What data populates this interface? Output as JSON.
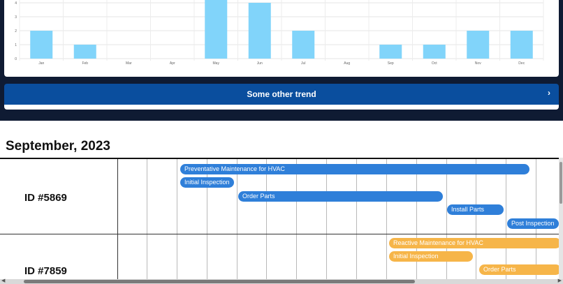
{
  "chart_data": {
    "type": "bar",
    "categories": [
      "Jan",
      "Feb",
      "Mar",
      "Apr",
      "May",
      "Jun",
      "Jul",
      "Aug",
      "Sep",
      "Oct",
      "Nov",
      "Dec"
    ],
    "values": [
      2,
      1,
      0,
      0,
      5,
      4,
      2,
      0,
      1,
      1,
      2,
      2
    ],
    "y_ticks": [
      "0",
      "1",
      "2",
      "3",
      "4"
    ],
    "ylim": [
      0,
      4.2
    ],
    "grid": true,
    "bar_color": "#81d4fa"
  },
  "trend": {
    "label": "Some other trend",
    "chevron": "›"
  },
  "schedule": {
    "month": "September, 2023",
    "rows": [
      {
        "id": "ID #5869",
        "color": "#2f7fd9",
        "tasks": [
          {
            "label": "Preventative Maintenance for HVAC"
          },
          {
            "label": "Initial Inspection"
          },
          {
            "label": "Order Parts"
          },
          {
            "label": "Install Parts"
          },
          {
            "label": "Post Inspection"
          }
        ]
      },
      {
        "id": "ID #7859",
        "color": "#f6b549",
        "tasks": [
          {
            "label": "Reactive Maintenance for HVAC"
          },
          {
            "label": "Initial Inspection"
          },
          {
            "label": "Order Parts"
          }
        ]
      }
    ]
  },
  "icons": {
    "scroll_left": "◀",
    "scroll_right": "▶"
  }
}
